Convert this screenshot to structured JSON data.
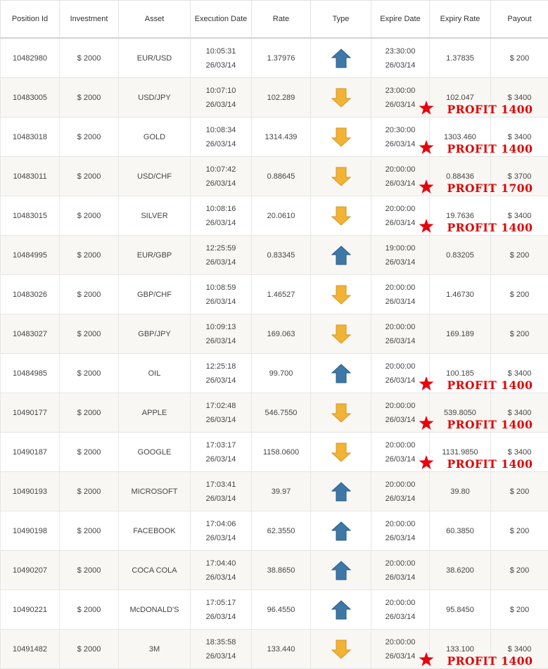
{
  "columns": [
    "Position Id",
    "Investment",
    "Asset",
    "Execution Date",
    "Rate",
    "Type",
    "Expire Date",
    "Expiry Rate",
    "Payout"
  ],
  "colors": {
    "up_arrow": "#3d78a8",
    "down_arrow": "#f2b233",
    "profit_text": "#e00000",
    "star": "#e8000c"
  },
  "rows": [
    {
      "id": "10482980",
      "investment": "$ 2000",
      "asset": "EUR/USD",
      "exec_time": "10:05:31",
      "exec_date": "26/03/14",
      "rate": "1.37976",
      "type": "up-arrow-icon",
      "exp_time": "23:30:00",
      "exp_date": "26/03/14",
      "expiry_rate": "1.37835",
      "payout": "$ 200",
      "profit": ""
    },
    {
      "id": "10483005",
      "investment": "$ 2000",
      "asset": "USD/JPY",
      "exec_time": "10:07:10",
      "exec_date": "26/03/14",
      "rate": "102.289",
      "type": "down-arrow-icon",
      "exp_time": "23:00:00",
      "exp_date": "26/03/14",
      "expiry_rate": "102.047",
      "payout": "$ 3400",
      "profit": "PROFIT 1400"
    },
    {
      "id": "10483018",
      "investment": "$ 2000",
      "asset": "GOLD",
      "exec_time": "10:08:34",
      "exec_date": "26/03/14",
      "rate": "1314.439",
      "type": "down-arrow-icon",
      "exp_time": "20:30:00",
      "exp_date": "26/03/14",
      "expiry_rate": "1303.460",
      "payout": "$ 3400",
      "profit": "PROFIT 1400"
    },
    {
      "id": "10483011",
      "investment": "$ 2000",
      "asset": "USD/CHF",
      "exec_time": "10:07:42",
      "exec_date": "26/03/14",
      "rate": "0.88645",
      "type": "down-arrow-icon",
      "exp_time": "20:00:00",
      "exp_date": "26/03/14",
      "expiry_rate": "0.88436",
      "payout": "$ 3700",
      "profit": "PROFIT 1700"
    },
    {
      "id": "10483015",
      "investment": "$ 2000",
      "asset": "SILVER",
      "exec_time": "10:08:16",
      "exec_date": "26/03/14",
      "rate": "20.0610",
      "type": "down-arrow-icon",
      "exp_time": "20:00:00",
      "exp_date": "26/03/14",
      "expiry_rate": "19.7636",
      "payout": "$ 3400",
      "profit": "PROFIT 1400"
    },
    {
      "id": "10484995",
      "investment": "$ 2000",
      "asset": "EUR/GBP",
      "exec_time": "12:25:59",
      "exec_date": "26/03/14",
      "rate": "0.83345",
      "type": "up-arrow-icon",
      "exp_time": "19:00:00",
      "exp_date": "26/03/14",
      "expiry_rate": "0.83205",
      "payout": "$ 200",
      "profit": ""
    },
    {
      "id": "10483026",
      "investment": "$ 2000",
      "asset": "GBP/CHF",
      "exec_time": "10:08:59",
      "exec_date": "26/03/14",
      "rate": "1.46527",
      "type": "down-arrow-icon",
      "exp_time": "20:00:00",
      "exp_date": "26/03/14",
      "expiry_rate": "1.46730",
      "payout": "$ 200",
      "profit": ""
    },
    {
      "id": "10483027",
      "investment": "$ 2000",
      "asset": "GBP/JPY",
      "exec_time": "10:09:13",
      "exec_date": "26/03/14",
      "rate": "169.063",
      "type": "down-arrow-icon",
      "exp_time": "20:00:00",
      "exp_date": "26/03/14",
      "expiry_rate": "169.189",
      "payout": "$ 200",
      "profit": ""
    },
    {
      "id": "10484985",
      "investment": "$ 2000",
      "asset": "OIL",
      "exec_time": "12:25:18",
      "exec_date": "26/03/14",
      "rate": "99.700",
      "type": "up-arrow-icon",
      "exp_time": "20:00:00",
      "exp_date": "26/03/14",
      "expiry_rate": "100.185",
      "payout": "$ 3400",
      "profit": "PROFIT 1400"
    },
    {
      "id": "10490177",
      "investment": "$ 2000",
      "asset": "APPLE",
      "exec_time": "17:02:48",
      "exec_date": "26/03/14",
      "rate": "546.7550",
      "type": "down-arrow-icon",
      "exp_time": "20:00:00",
      "exp_date": "26/03/14",
      "expiry_rate": "539.8050",
      "payout": "$ 3400",
      "profit": "PROFIT 1400"
    },
    {
      "id": "10490187",
      "investment": "$ 2000",
      "asset": "GOOGLE",
      "exec_time": "17:03:17",
      "exec_date": "26/03/14",
      "rate": "1158.0600",
      "type": "down-arrow-icon",
      "exp_time": "20:00:00",
      "exp_date": "26/03/14",
      "expiry_rate": "1131.9850",
      "payout": "$ 3400",
      "profit": "PROFIT 1400"
    },
    {
      "id": "10490193",
      "investment": "$ 2000",
      "asset": "MICROSOFT",
      "exec_time": "17:03:41",
      "exec_date": "26/03/14",
      "rate": "39.97",
      "type": "up-arrow-icon",
      "exp_time": "20:00:00",
      "exp_date": "26/03/14",
      "expiry_rate": "39.80",
      "payout": "$ 200",
      "profit": ""
    },
    {
      "id": "10490198",
      "investment": "$ 2000",
      "asset": "FACEBOOK",
      "exec_time": "17:04:06",
      "exec_date": "26/03/14",
      "rate": "62.3550",
      "type": "up-arrow-icon",
      "exp_time": "20:00:00",
      "exp_date": "26/03/14",
      "expiry_rate": "60.3850",
      "payout": "$ 200",
      "profit": ""
    },
    {
      "id": "10490207",
      "investment": "$ 2000",
      "asset": "COCA COLA",
      "exec_time": "17:04:40",
      "exec_date": "26/03/14",
      "rate": "38.8650",
      "type": "up-arrow-icon",
      "exp_time": "20:00:00",
      "exp_date": "26/03/14",
      "expiry_rate": "38.6200",
      "payout": "$ 200",
      "profit": ""
    },
    {
      "id": "10490221",
      "investment": "$ 2000",
      "asset": "McDONALD'S",
      "exec_time": "17:05:17",
      "exec_date": "26/03/14",
      "rate": "96.4550",
      "type": "up-arrow-icon",
      "exp_time": "20:00:00",
      "exp_date": "26/03/14",
      "expiry_rate": "95.8450",
      "payout": "$ 200",
      "profit": ""
    },
    {
      "id": "10491482",
      "investment": "$ 2000",
      "asset": "3M",
      "exec_time": "18:35:58",
      "exec_date": "26/03/14",
      "rate": "133.440",
      "type": "down-arrow-icon",
      "exp_time": "20:00:00",
      "exp_date": "26/03/14",
      "expiry_rate": "133.100",
      "payout": "$ 3400",
      "profit": "PROFIT 1400"
    }
  ]
}
